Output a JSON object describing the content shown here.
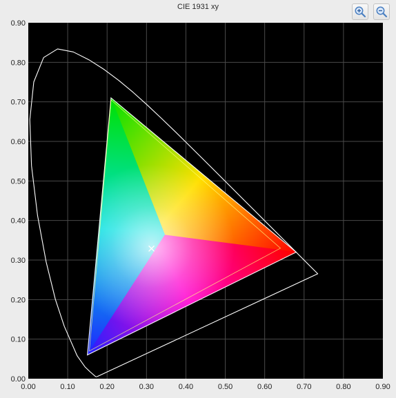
{
  "window": {
    "title": "CIE 1931 xy"
  },
  "toolbar": {
    "zoom_in_icon": "zoom-in-magnifier-icon",
    "zoom_out_icon": "zoom-out-magnifier-icon"
  },
  "colors": {
    "plot_background": "#000000",
    "grid": "#4a4a4a",
    "locus": "#ffffff",
    "white_point": "#ffffff"
  },
  "chart_data": {
    "type": "scatter",
    "title": "CIE 1931 xy",
    "xlabel": "",
    "ylabel": "",
    "xlim": [
      0,
      0.9
    ],
    "ylim": [
      0,
      0.9
    ],
    "grid": true,
    "x_ticks": [
      "0.00",
      "0.10",
      "0.20",
      "0.30",
      "0.40",
      "0.50",
      "0.60",
      "0.70",
      "0.80",
      "0.90"
    ],
    "y_ticks": [
      "0.00",
      "0.10",
      "0.20",
      "0.30",
      "0.40",
      "0.50",
      "0.60",
      "0.70",
      "0.80",
      "0.90"
    ],
    "spectral_locus": [
      [
        0.1741,
        0.005
      ],
      [
        0.1721,
        0.0048
      ],
      [
        0.1689,
        0.0069
      ],
      [
        0.1644,
        0.0109
      ],
      [
        0.1566,
        0.0177
      ],
      [
        0.144,
        0.0297
      ],
      [
        0.1241,
        0.0578
      ],
      [
        0.0913,
        0.1327
      ],
      [
        0.0687,
        0.2007
      ],
      [
        0.0454,
        0.295
      ],
      [
        0.0235,
        0.4127
      ],
      [
        0.0082,
        0.5384
      ],
      [
        0.0039,
        0.6548
      ],
      [
        0.0139,
        0.7502
      ],
      [
        0.0389,
        0.812
      ],
      [
        0.0743,
        0.8338
      ],
      [
        0.1142,
        0.8262
      ],
      [
        0.1547,
        0.8059
      ],
      [
        0.1929,
        0.7816
      ],
      [
        0.2296,
        0.7543
      ],
      [
        0.2658,
        0.7243
      ],
      [
        0.3016,
        0.6923
      ],
      [
        0.3373,
        0.6589
      ],
      [
        0.3731,
        0.6245
      ],
      [
        0.4087,
        0.5896
      ],
      [
        0.4441,
        0.5547
      ],
      [
        0.4788,
        0.5202
      ],
      [
        0.5125,
        0.4866
      ],
      [
        0.5448,
        0.4544
      ],
      [
        0.5752,
        0.4242
      ],
      [
        0.6029,
        0.3965
      ],
      [
        0.627,
        0.3725
      ],
      [
        0.6482,
        0.3514
      ],
      [
        0.6658,
        0.334
      ],
      [
        0.6915,
        0.3083
      ],
      [
        0.714,
        0.2859
      ],
      [
        0.7347,
        0.2653
      ],
      [
        0.1741,
        0.005
      ]
    ],
    "gamut_triangle": {
      "red": [
        0.68,
        0.32
      ],
      "green": [
        0.21,
        0.71
      ],
      "blue": [
        0.15,
        0.06
      ]
    },
    "inner_triangle": {
      "red": [
        0.64,
        0.33
      ],
      "green": [
        0.21,
        0.705
      ],
      "blue": [
        0.155,
        0.07
      ]
    },
    "white_point": [
      0.3127,
      0.329
    ]
  }
}
